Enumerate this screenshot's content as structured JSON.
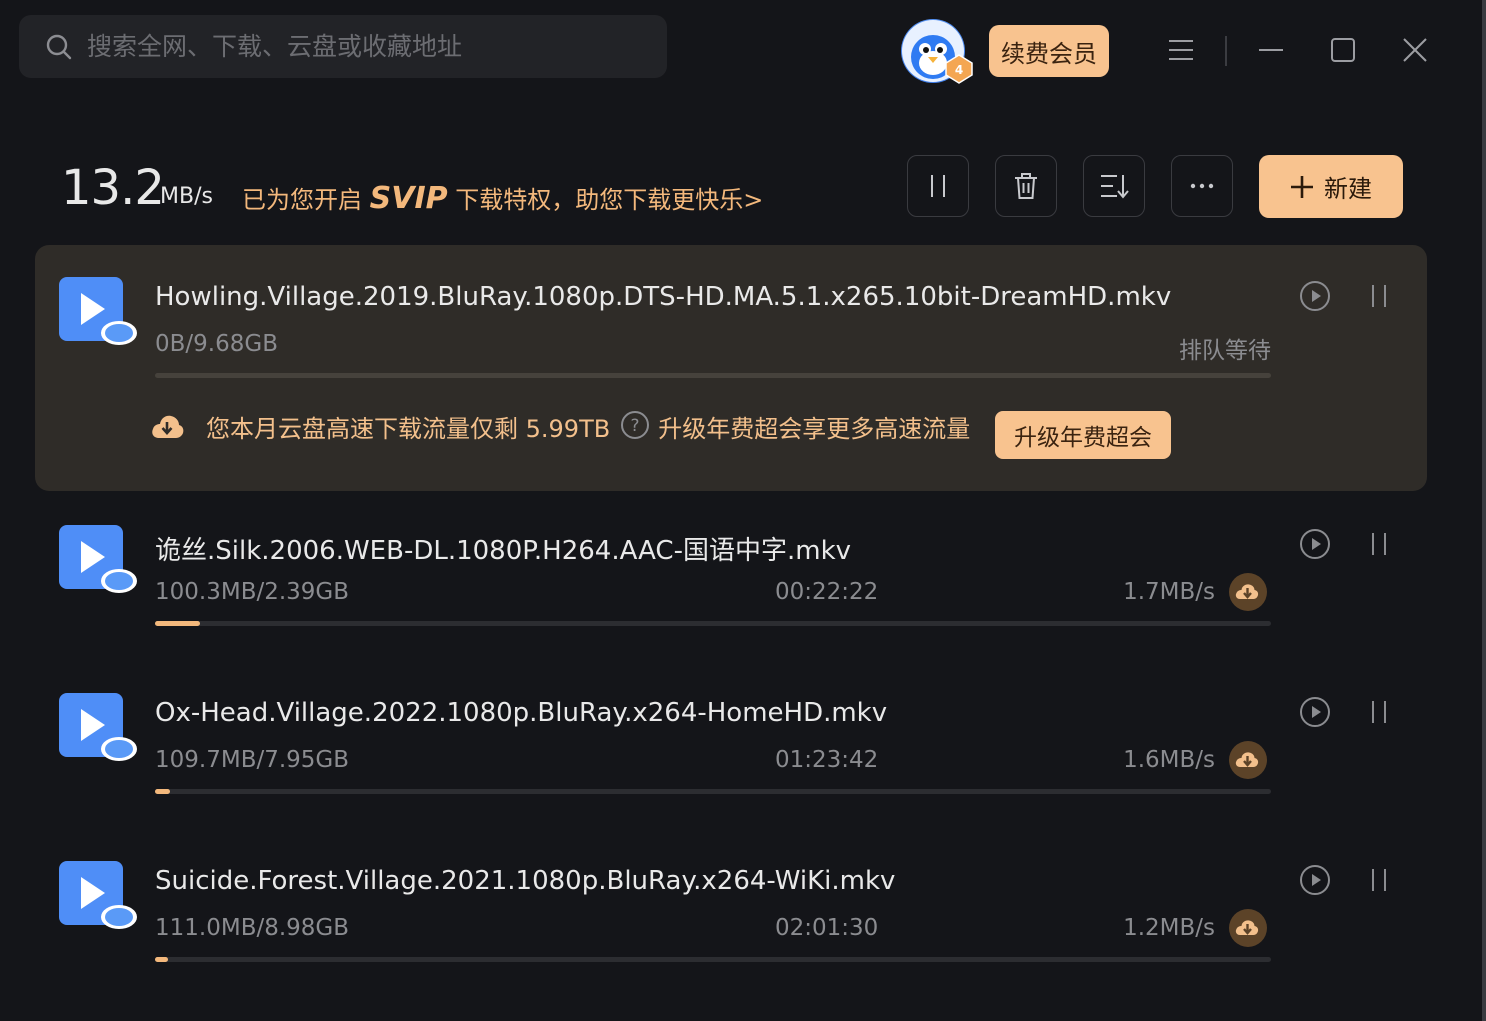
{
  "search": {
    "placeholder": "搜索全网、下载、云盘或收藏地址"
  },
  "header": {
    "vip_level": "4",
    "renew_label": "续费会员"
  },
  "summary": {
    "speed_value": "13.2",
    "speed_unit": "MB/s",
    "svip_prefix": "已为您开启 ",
    "svip_word": "SVIP",
    "svip_suffix": " 下载特权，助您下载更快乐>"
  },
  "toolbar": {
    "new_label": "新建"
  },
  "tasks": [
    {
      "name": "Howling.Village.2019.BluRay.1080p.DTS-HD.MA.5.1.x265.10bit-DreamHD.mkv",
      "size": "0B/9.68GB",
      "status": "排队等待",
      "progress": 0,
      "quota_text": "您本月云盘高速下载流量仅剩 5.99TB",
      "quota_upsell": "升级年费超会享更多高速流量",
      "upgrade_label": "升级年费超会"
    },
    {
      "name": "诡丝.Silk.2006.WEB-DL.1080P.H264.AAC-国语中字.mkv",
      "size": "100.3MB/2.39GB",
      "time": "00:22:22",
      "speed": "1.7MB/s",
      "progress": 0.04
    },
    {
      "name": "Ox-Head.Village.2022.1080p.BluRay.x264-HomeHD.mkv",
      "size": "109.7MB/7.95GB",
      "time": "01:23:42",
      "speed": "1.6MB/s",
      "progress": 0.013
    },
    {
      "name": "Suicide.Forest.Village.2021.1080p.BluRay.x264-WiKi.mkv",
      "size": "111.0MB/8.98GB",
      "time": "02:01:30",
      "speed": "1.2MB/s",
      "progress": 0.012
    }
  ],
  "colors": {
    "background": "#141519",
    "accent": "#f8c38f",
    "accent_text": "#f3b87c",
    "active_row": "#2f2c28"
  }
}
